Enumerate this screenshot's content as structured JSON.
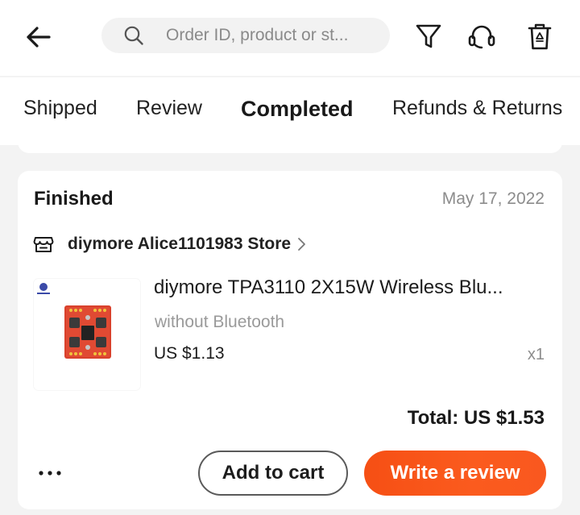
{
  "header": {
    "back_icon": "arrow-left-icon",
    "search": {
      "icon": "search-icon",
      "placeholder": "Order ID, product or st...",
      "value": ""
    },
    "actions": [
      {
        "icon": "filter-icon"
      },
      {
        "icon": "headset-icon"
      },
      {
        "icon": "trash-icon"
      }
    ]
  },
  "tabs": [
    {
      "label": "Shipped",
      "active": false
    },
    {
      "label": "Review",
      "active": false
    },
    {
      "label": "Completed",
      "active": true
    },
    {
      "label": "Refunds & Returns",
      "active": false
    }
  ],
  "order": {
    "status": "Finished",
    "date": "May 17, 2022",
    "store": {
      "icon": "store-icon",
      "name": "diymore Alice1101983 Store"
    },
    "item": {
      "title": "diymore TPA3110 2X15W Wireless Blu...",
      "variant": "without Bluetooth",
      "price": "US $1.13",
      "quantity": "x1"
    },
    "total": "Total: US $1.53",
    "more_label": "•••",
    "buttons": {
      "add_to_cart": "Add to cart",
      "write_review": "Write a review"
    }
  },
  "colors": {
    "accent": "#f04a28",
    "review_button": "#f9581f",
    "page_background": "#f3f3f3",
    "card_background": "#ffffff",
    "secondary_text": "#8c8c8c"
  }
}
